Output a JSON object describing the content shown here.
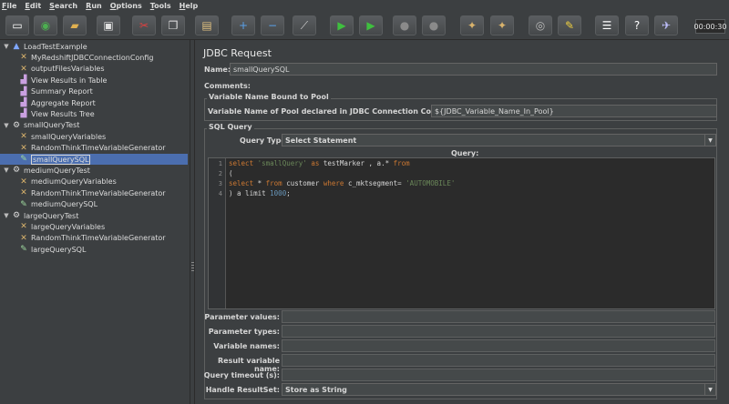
{
  "menu": [
    "File",
    "Edit",
    "Search",
    "Run",
    "Options",
    "Tools",
    "Help"
  ],
  "toolbar": {
    "buttons": [
      {
        "name": "new-icon",
        "glyph": "▭",
        "color": "#ffffff"
      },
      {
        "name": "templates-icon",
        "glyph": "◉",
        "color": "#4caf50"
      },
      {
        "name": "open-icon",
        "glyph": "▰",
        "color": "#e0b050"
      },
      {
        "name": "save-icon",
        "glyph": "▣",
        "color": "#e0e0e0"
      },
      {
        "name": "cut-icon",
        "glyph": "✂",
        "color": "#e04040"
      },
      {
        "name": "copy-icon",
        "glyph": "❐",
        "color": "#e0e0e0"
      },
      {
        "name": "paste-icon",
        "glyph": "▤",
        "color": "#e0c080"
      },
      {
        "name": "expand-icon",
        "glyph": "+",
        "color": "#5aa0e8"
      },
      {
        "name": "collapse-icon",
        "glyph": "−",
        "color": "#5aa0e8"
      },
      {
        "name": "toggle-icon",
        "glyph": "⟋",
        "color": "#cfcfcf"
      },
      {
        "name": "start-icon",
        "glyph": "▶",
        "color": "#3fbf3f"
      },
      {
        "name": "start-no-pauses-icon",
        "glyph": "▶",
        "color": "#3fbf3f"
      },
      {
        "name": "stop-icon",
        "glyph": "●",
        "color": "#8a8a8a"
      },
      {
        "name": "shutdown-icon",
        "glyph": "●",
        "color": "#8a8a8a"
      },
      {
        "name": "clear-icon",
        "glyph": "✦",
        "color": "#d9b36c"
      },
      {
        "name": "clear-all-icon",
        "glyph": "✦",
        "color": "#d9b36c"
      },
      {
        "name": "search-icon",
        "glyph": "◎",
        "color": "#bbbbbb"
      },
      {
        "name": "reset-search-icon",
        "glyph": "✎",
        "color": "#f0d040"
      },
      {
        "name": "function-helper-icon",
        "glyph": "☰",
        "color": "#ffffff"
      },
      {
        "name": "help-icon",
        "glyph": "?",
        "color": "#ffffff"
      },
      {
        "name": "remote-icon",
        "glyph": "✈",
        "color": "#c0c0ff"
      }
    ],
    "timer": "00:00:30"
  },
  "tree": {
    "nodes": [
      {
        "label": "LoadTestExample",
        "icon": "testplan-icon",
        "glyph": "▲",
        "color": "#7fa7ff",
        "toggle": "▼",
        "selected": false
      },
      {
        "label": "MyRedshiftJDBCConnectionConfig",
        "icon": "config-icon",
        "glyph": "✕",
        "color": "#d9b36c",
        "toggle": "",
        "selected": false
      },
      {
        "label": "outputFilesVariables",
        "icon": "config-icon",
        "glyph": "✕",
        "color": "#d9b36c",
        "toggle": "",
        "selected": false
      },
      {
        "label": "View Results in Table",
        "icon": "listener-icon",
        "glyph": "▟",
        "color": "#c9a0e0",
        "toggle": "",
        "selected": false
      },
      {
        "label": "Summary Report",
        "icon": "listener-icon",
        "glyph": "▟",
        "color": "#c9a0e0",
        "toggle": "",
        "selected": false
      },
      {
        "label": "Aggregate Report",
        "icon": "listener-icon",
        "glyph": "▟",
        "color": "#c9a0e0",
        "toggle": "",
        "selected": false
      },
      {
        "label": "View Results Tree",
        "icon": "listener-icon",
        "glyph": "▟",
        "color": "#c9a0e0",
        "toggle": "",
        "selected": false
      },
      {
        "label": "smallQueryTest",
        "icon": "threadgroup-icon",
        "glyph": "⚙",
        "color": "#dddddd",
        "toggle": "▼",
        "selected": false
      },
      {
        "label": "smallQueryVariables",
        "icon": "config-icon",
        "glyph": "✕",
        "color": "#d9b36c",
        "toggle": "",
        "selected": false
      },
      {
        "label": "RandomThinkTimeVariableGenerator",
        "icon": "config-icon",
        "glyph": "✕",
        "color": "#d9b36c",
        "toggle": "",
        "selected": false
      },
      {
        "label": "smallQuerySQL",
        "icon": "sampler-icon",
        "glyph": "✎",
        "color": "#9fd99f",
        "toggle": "",
        "selected": true
      },
      {
        "label": "mediumQueryTest",
        "icon": "threadgroup-icon",
        "glyph": "⚙",
        "color": "#dddddd",
        "toggle": "▼",
        "selected": false
      },
      {
        "label": "mediumQueryVariables",
        "icon": "config-icon",
        "glyph": "✕",
        "color": "#d9b36c",
        "toggle": "",
        "selected": false
      },
      {
        "label": "RandomThinkTimeVariableGenerator",
        "icon": "config-icon",
        "glyph": "✕",
        "color": "#d9b36c",
        "toggle": "",
        "selected": false
      },
      {
        "label": "mediumQuerySQL",
        "icon": "sampler-icon",
        "glyph": "✎",
        "color": "#9fd99f",
        "toggle": "",
        "selected": false
      },
      {
        "label": "largeQueryTest",
        "icon": "threadgroup-icon",
        "glyph": "⚙",
        "color": "#dddddd",
        "toggle": "▼",
        "selected": false
      },
      {
        "label": "largeQueryVariables",
        "icon": "config-icon",
        "glyph": "✕",
        "color": "#d9b36c",
        "toggle": "",
        "selected": false
      },
      {
        "label": "RandomThinkTimeVariableGenerator",
        "icon": "config-icon",
        "glyph": "✕",
        "color": "#d9b36c",
        "toggle": "",
        "selected": false
      },
      {
        "label": "largeQuerySQL",
        "icon": "sampler-icon",
        "glyph": "✎",
        "color": "#9fd99f",
        "toggle": "",
        "selected": false
      }
    ]
  },
  "panel": {
    "title": "JDBC Request",
    "name_label": "Name:",
    "name_value": "smallQuerySQL",
    "comments_label": "Comments:",
    "pool_section": "Variable Name Bound to Pool",
    "pool_label": "Variable Name of Pool declared in JDBC Connection Configuration:",
    "pool_value": "${JDBC_Variable_Name_In_Pool}",
    "sql_section": "SQL Query",
    "query_type_label": "Query Type:",
    "query_type_value": "Select Statement",
    "query_label": "Query:",
    "line_numbers": [
      "1",
      "2",
      "3",
      "4"
    ],
    "params": [
      {
        "label": "Parameter values:",
        "value": ""
      },
      {
        "label": "Parameter types:",
        "value": ""
      },
      {
        "label": "Variable names:",
        "value": ""
      },
      {
        "label": "Result variable name:",
        "value": ""
      },
      {
        "label": "Query timeout (s):",
        "value": ""
      }
    ],
    "handle_label": "Handle ResultSet:",
    "handle_value": "Store as String"
  },
  "code": {
    "line1": {
      "kw1": "select",
      "str1": "'smallQuery'",
      "kw2": "as",
      "text1": " testMarker , a.* ",
      "kw3": "from"
    },
    "line2": {
      "text": "("
    },
    "line3": {
      "kw1": "select",
      "text1": " * ",
      "kw2": "from",
      "text2": " customer ",
      "kw3": "where",
      "text3": " c_mktsegment= ",
      "str1": "'AUTOMOBILE'"
    },
    "line4": {
      "text1": ") a limit ",
      "num1": "1000",
      "text2": ";"
    }
  }
}
